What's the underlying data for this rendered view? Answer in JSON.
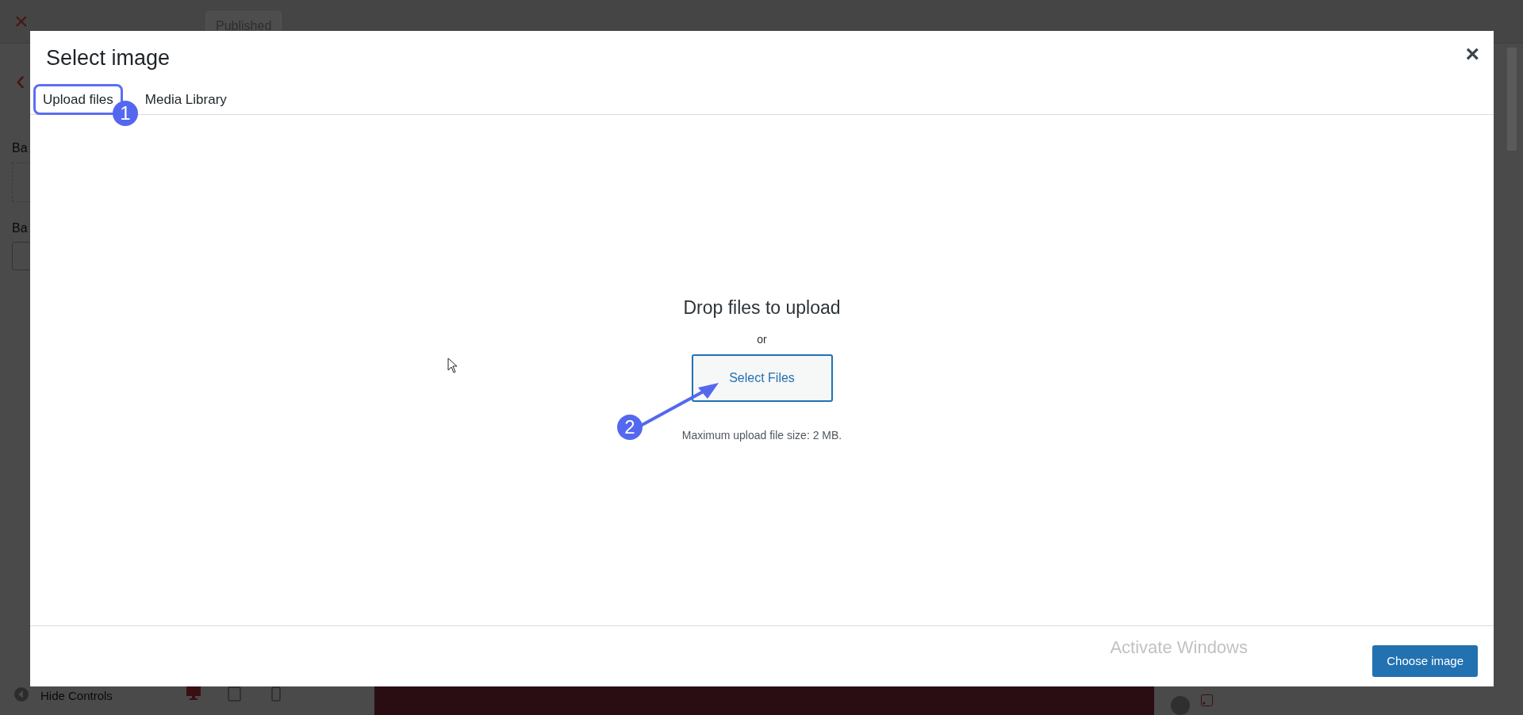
{
  "background": {
    "close": "×",
    "publish_button": "Published",
    "back": "‹",
    "labels": [
      "Ba",
      "Ba"
    ],
    "hide_controls": "Hide Controls"
  },
  "modal": {
    "title": "Select image",
    "close": "×",
    "tabs": [
      {
        "label": "Upload files",
        "selected": true
      },
      {
        "label": "Media Library",
        "selected": false
      }
    ],
    "upload": {
      "heading": "Drop files to upload",
      "or": "or",
      "button": "Select Files",
      "note": "Maximum upload file size: 2 MB."
    },
    "footer": {
      "button": "Choose image",
      "disabled": false
    },
    "annotations": [
      {
        "number": "1"
      },
      {
        "number": "2"
      }
    ]
  },
  "os_notice": "Activate Windows"
}
